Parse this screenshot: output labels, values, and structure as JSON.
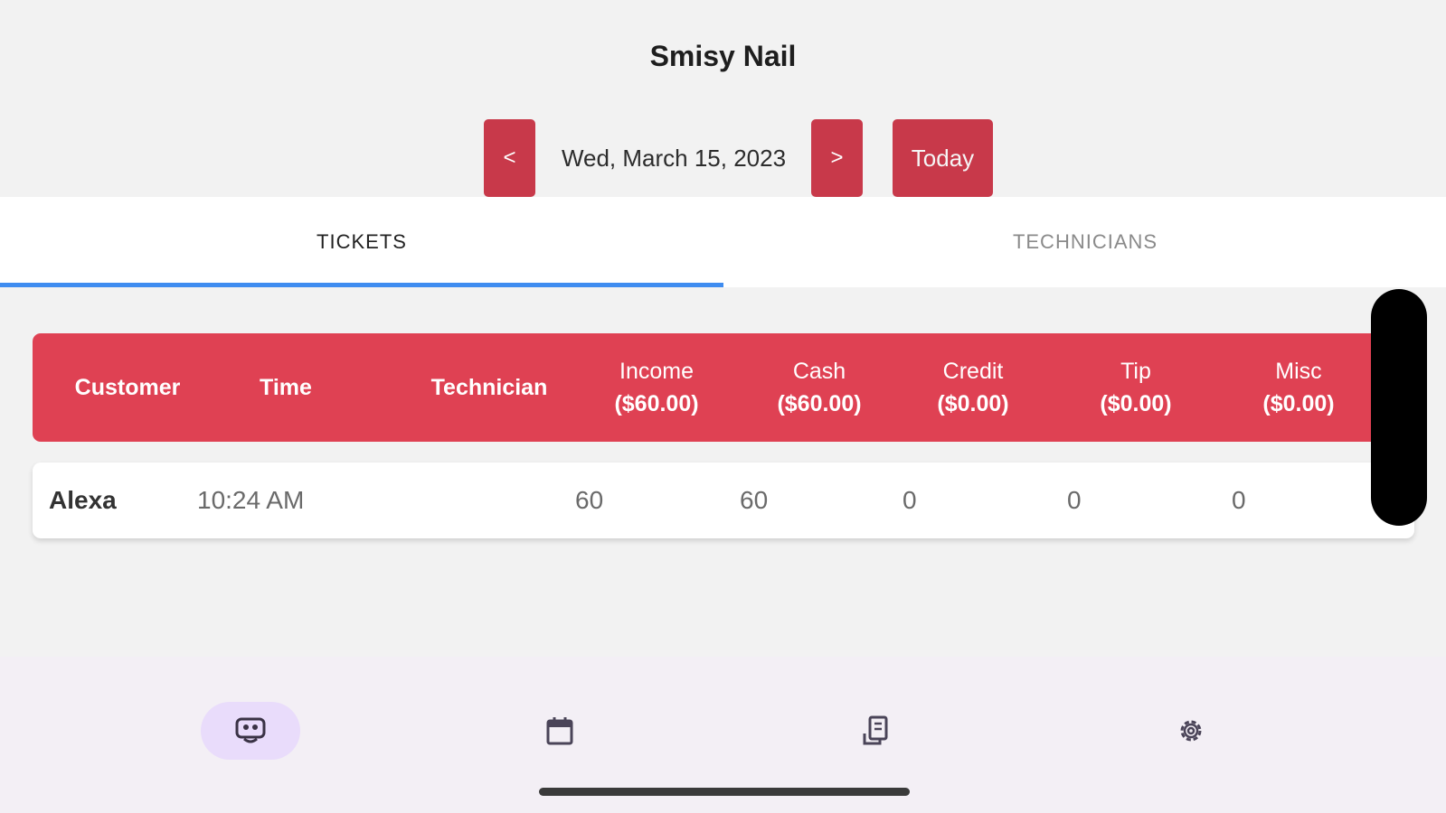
{
  "app": {
    "title": "Smisy Nail"
  },
  "datebar": {
    "prev_label": "<",
    "date": "Wed, March 15, 2023",
    "next_label": ">",
    "today_label": "Today"
  },
  "tabs": [
    {
      "label": "TICKETS",
      "active": true
    },
    {
      "label": "TECHNICIANS",
      "active": false
    }
  ],
  "table": {
    "headers": {
      "customer": "Customer",
      "time": "Time",
      "technician": "Technician",
      "income": "Income",
      "income_total": "($60.00)",
      "cash": "Cash",
      "cash_total": "($60.00)",
      "credit": "Credit",
      "credit_total": "($0.00)",
      "tip": "Tip",
      "tip_total": "($0.00)",
      "misc": "Misc",
      "misc_total": "($0.00)"
    },
    "rows": [
      {
        "customer": "Alexa",
        "time": "10:24 AM",
        "technician": "",
        "income": "60",
        "cash": "60",
        "credit": "0",
        "tip": "0",
        "misc": "0"
      }
    ]
  },
  "bottom_nav": [
    {
      "icon": "tickets-icon",
      "active": true
    },
    {
      "icon": "calendar-icon",
      "active": false
    },
    {
      "icon": "report-icon",
      "active": false
    },
    {
      "icon": "gear-icon",
      "active": false
    }
  ],
  "colors": {
    "accent_red": "#c8394a",
    "header_red": "#df4153",
    "tab_indicator": "#3f8cf0",
    "active_nav_bg": "#e9dcfb"
  }
}
